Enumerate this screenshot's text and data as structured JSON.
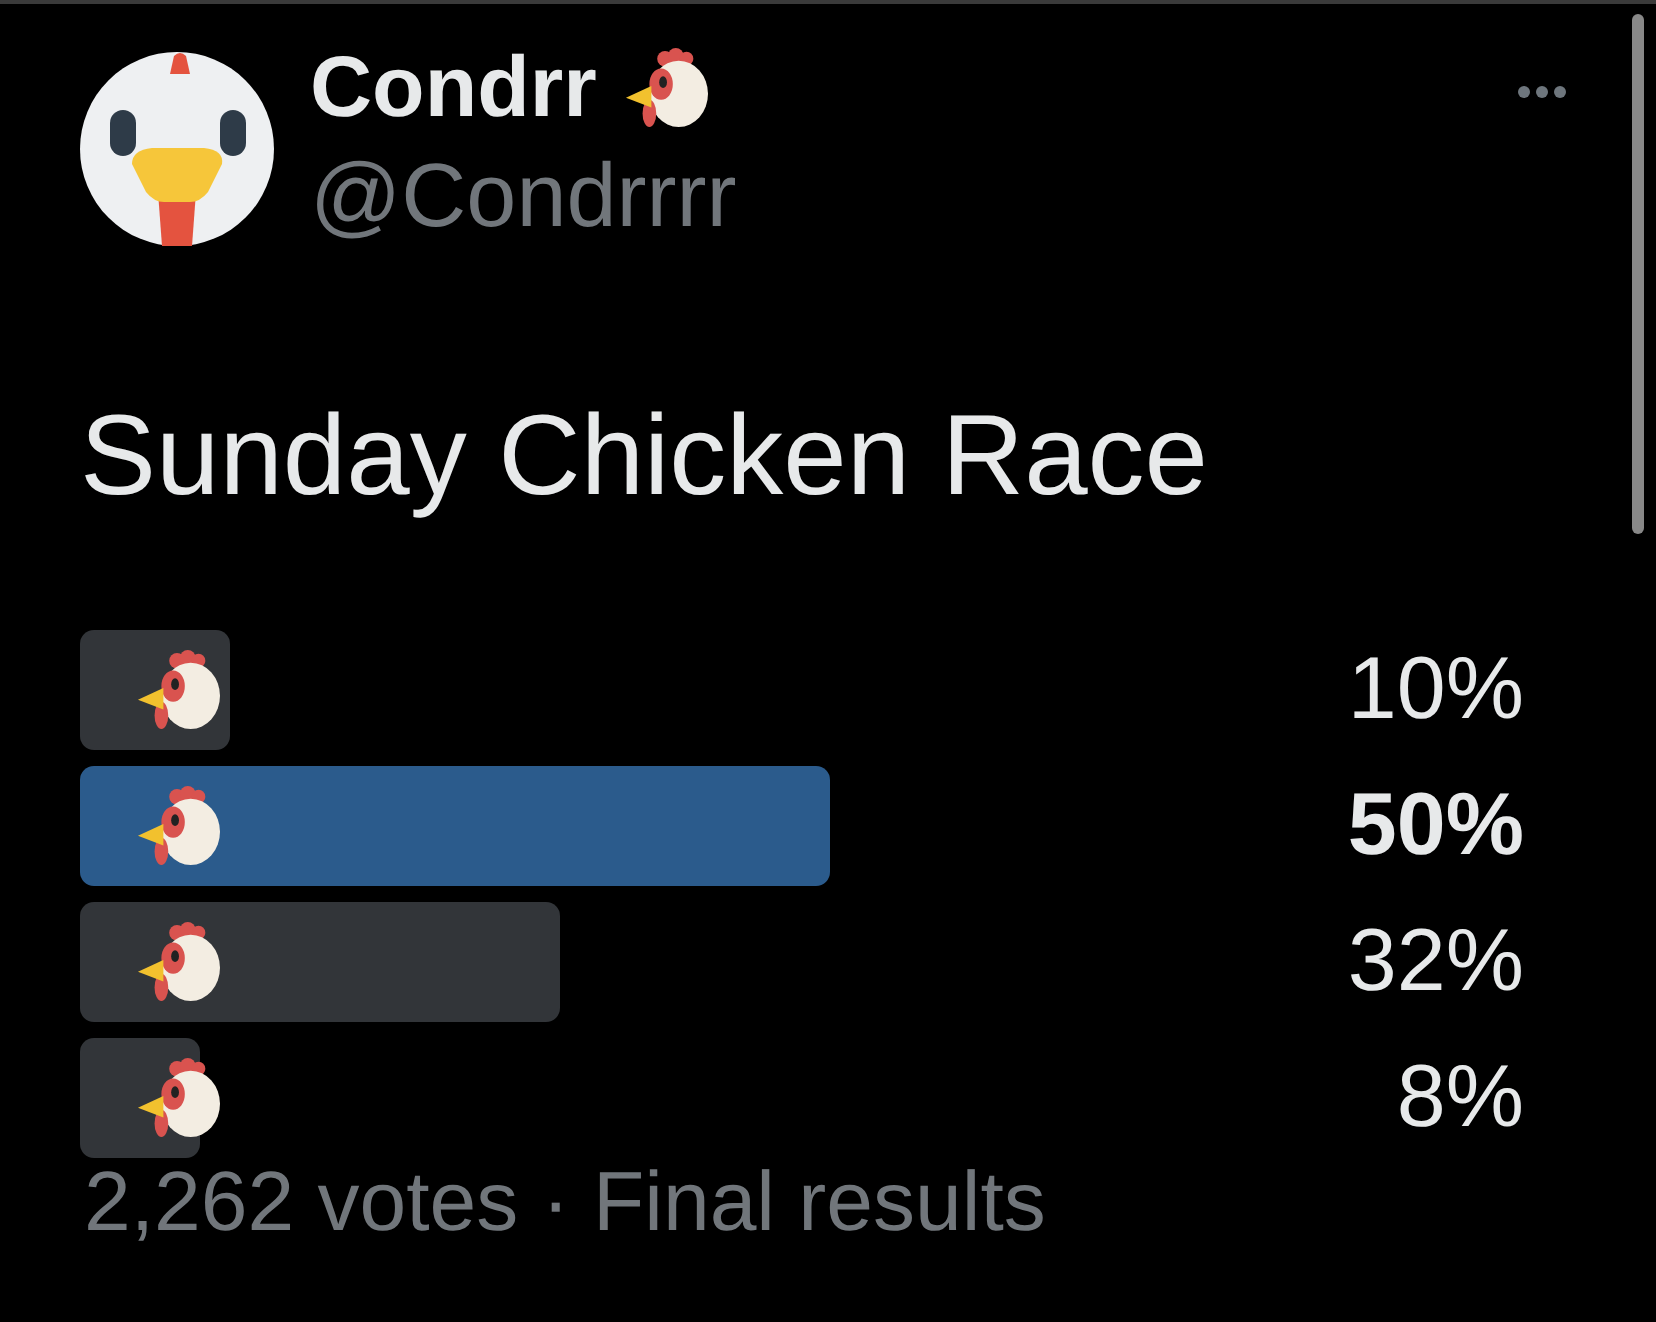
{
  "author": {
    "name": "Condrr",
    "handle": "@Condrrrr"
  },
  "tweet": {
    "text": "Sunday Chicken Race"
  },
  "poll": {
    "options": [
      {
        "percent": "10%",
        "level": 0.1,
        "leading": false
      },
      {
        "percent": "50%",
        "level": 0.5,
        "leading": true
      },
      {
        "percent": "32%",
        "level": 0.32,
        "leading": false
      },
      {
        "percent": "8%",
        "level": 0.08,
        "leading": false
      }
    ],
    "summary": "2,262 votes · Final results"
  }
}
